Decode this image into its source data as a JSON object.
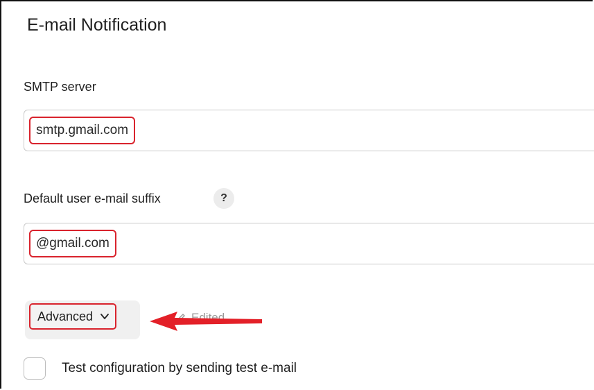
{
  "section": {
    "title": "E-mail Notification"
  },
  "smtp": {
    "label": "SMTP server",
    "value": "smtp.gmail.com"
  },
  "suffix": {
    "label": "Default user e-mail suffix",
    "help": "?",
    "value": "@gmail.com"
  },
  "advanced": {
    "label": "Advanced",
    "status": "Edited"
  },
  "test": {
    "label": "Test configuration by sending test e-mail",
    "checked": false
  },
  "colors": {
    "highlight": "#d9232d",
    "arrow": "#e32028"
  },
  "icons": {
    "chevron": "chevron-down-icon",
    "edited": "edit-icon",
    "annotation": "red-arrow-icon"
  }
}
